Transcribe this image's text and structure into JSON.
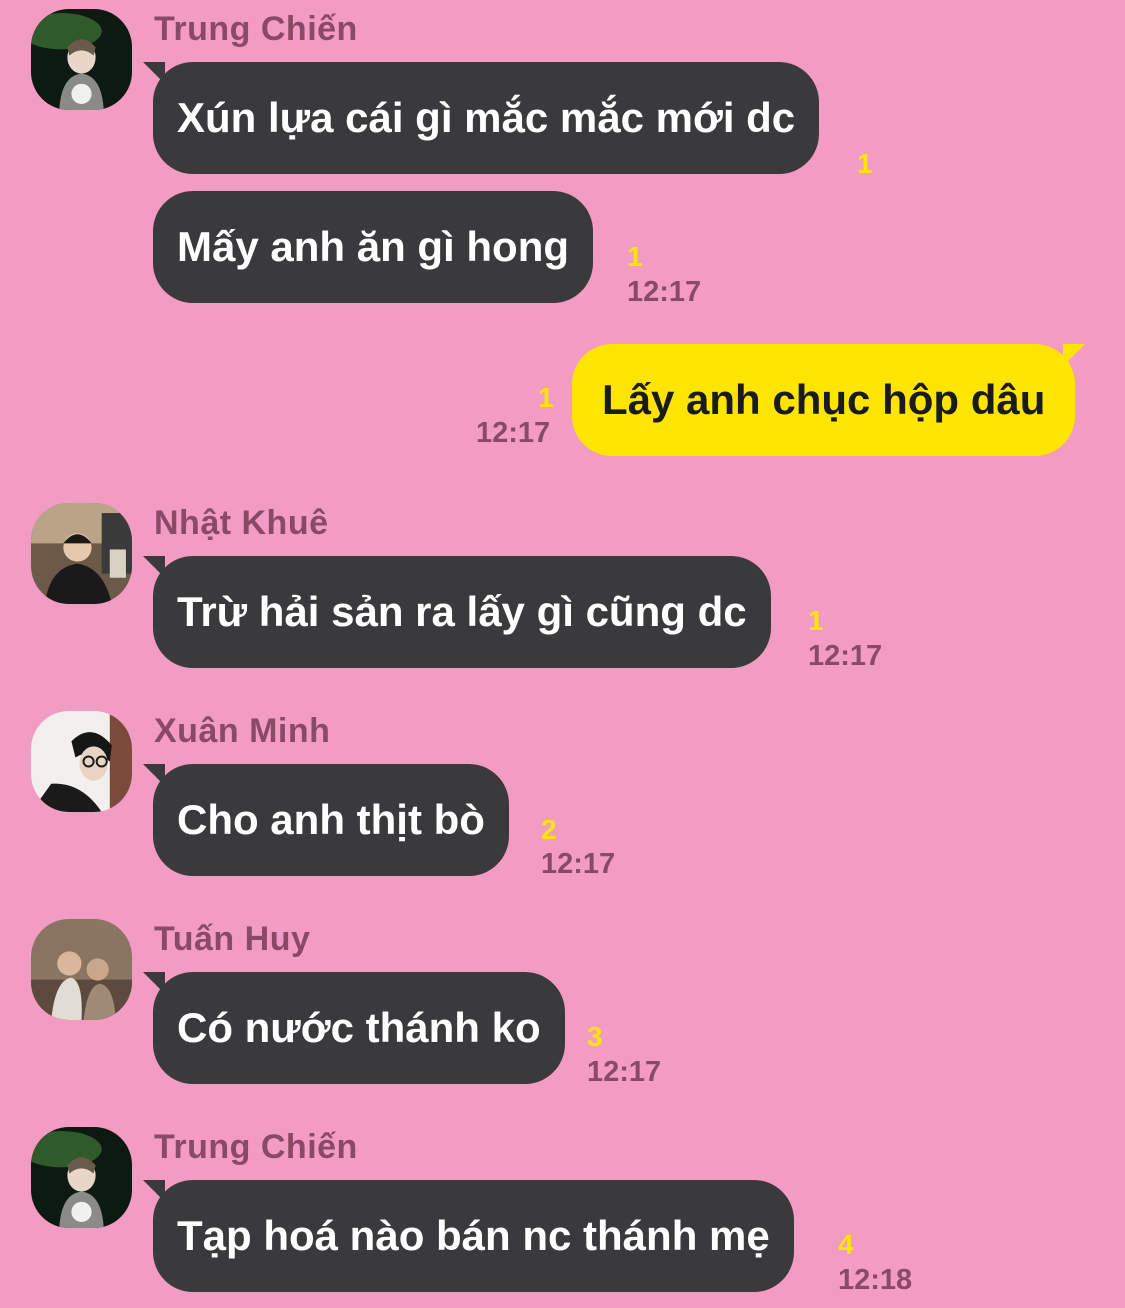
{
  "messages": [
    {
      "sender": "Trung Chiến",
      "text": "Xún lựa cái gì mắc mắc mới dc",
      "unread": "1"
    },
    {
      "text": "Mấy anh ăn gì hong",
      "unread": "1",
      "time": "12:17"
    },
    {
      "text": "Lấy anh chục hộp dâu",
      "unread": "1",
      "time": "12:17"
    },
    {
      "sender": "Nhật Khuê",
      "text": "Trừ hải sản ra lấy gì cũng dc",
      "unread": "1",
      "time": "12:17"
    },
    {
      "sender": "Xuân Minh",
      "text": "Cho anh thịt bò",
      "unread": "2",
      "time": "12:17"
    },
    {
      "sender": "Tuấn Huy",
      "text": "Có nước thánh ko",
      "unread": "3",
      "time": "12:17"
    },
    {
      "sender": "Trung Chiến",
      "text": "Tạp hoá nào bán nc thánh mẹ",
      "unread": "4",
      "time": "12:18"
    }
  ],
  "colors": {
    "background": "#f29bc3",
    "received_bubble": "#3a3a3c",
    "sent_bubble": "#fee500",
    "unread_count": "#fee500",
    "meta_text": "#8a4a66"
  }
}
